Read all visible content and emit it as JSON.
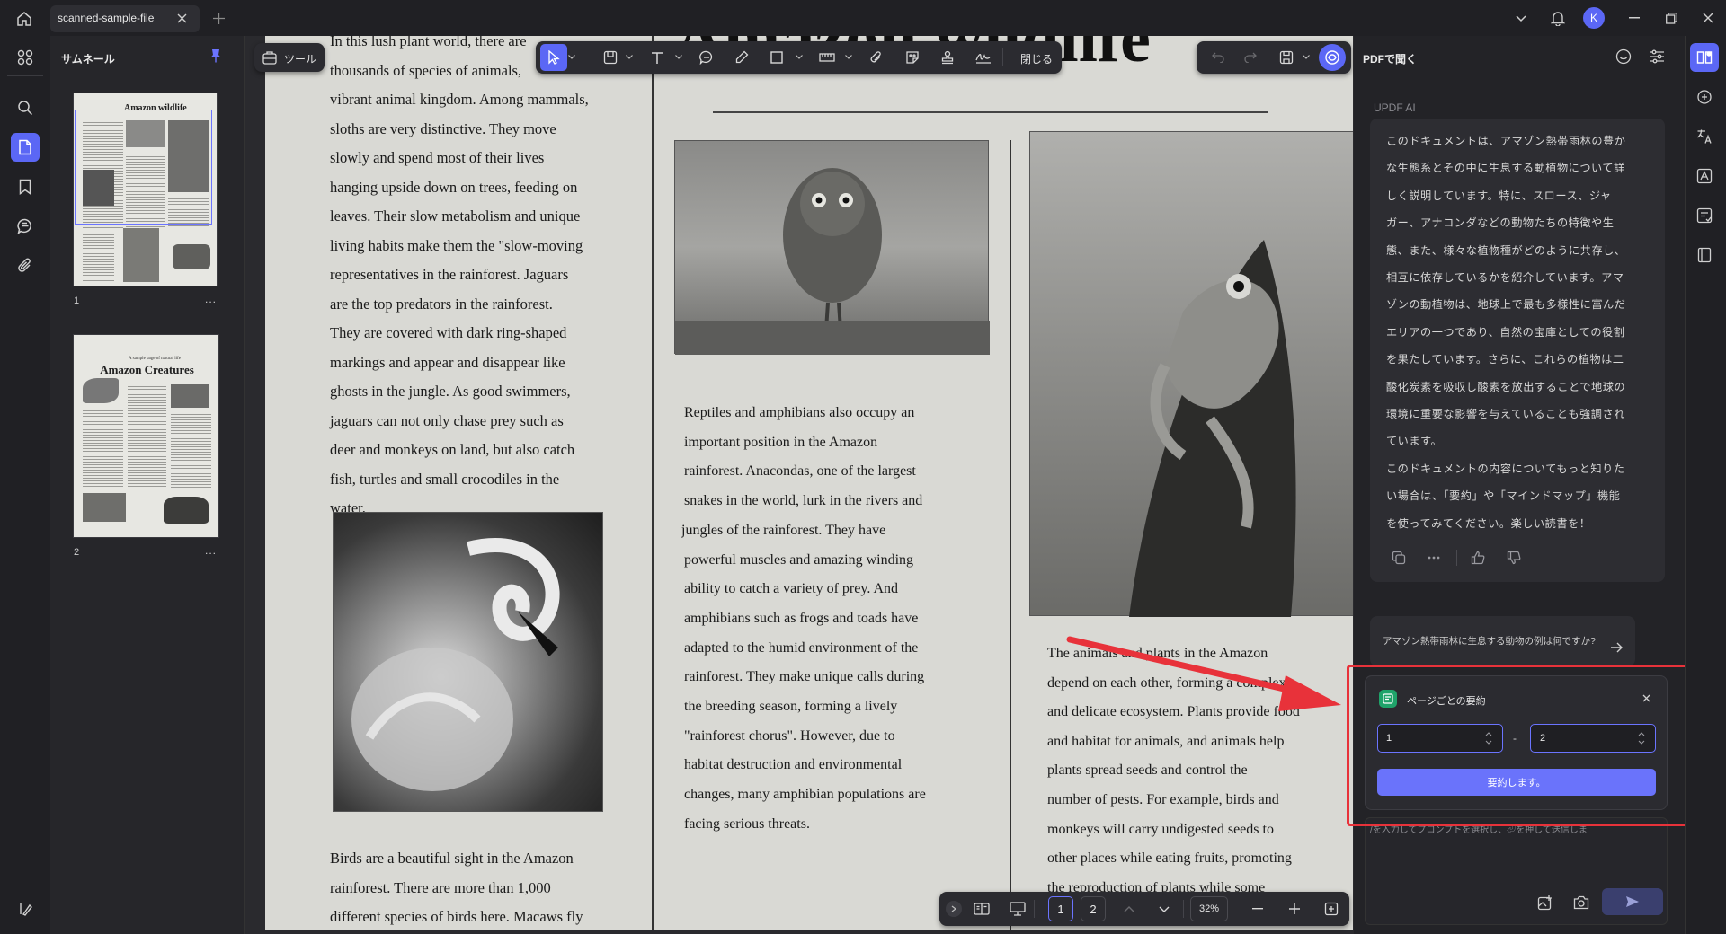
{
  "tabs": [
    {
      "title": "scanned-sample-file"
    }
  ],
  "user": {
    "avatar_initial": "K",
    "avatar_color": "#5b67f5"
  },
  "thumbnails": {
    "title": "サムネール",
    "pages": [
      {
        "number": "1",
        "heading": "Amazon wildlife",
        "more": "..."
      },
      {
        "number": "2",
        "heading": "Amazon Creatures",
        "kicker": "A sample page of natural life",
        "more": "..."
      }
    ]
  },
  "toolbar": {
    "tools_label": "ツール",
    "close_label": "閉じる"
  },
  "page_nav": {
    "pages": [
      "1",
      "2"
    ],
    "current": "1",
    "zoom": "32%"
  },
  "document": {
    "title": "Amazon wildlife",
    "col1_lines": [
      "In this lush plant world, there are",
      "thousands of species of animals,",
      "vibrant animal kingdom. Among mammals,",
      "sloths are very distinctive. They move",
      "slowly and spend most of their lives",
      "hanging upside down on trees, feeding on",
      "leaves. Their slow metabolism and unique",
      "living habits make them the \"slow-moving",
      "representatives in the rainforest. Jaguars",
      "are the top predators in the rainforest.",
      "They are covered with dark ring-shaped",
      "markings and appear and disappear like",
      "ghosts in the jungle. As good swimmers,",
      "jaguars can not only chase prey such as",
      "deer and monkeys on land, but also catch",
      "fish, turtles and small crocodiles in the",
      "water."
    ],
    "col1_bottom_lines": [
      "Birds are a beautiful sight in the Amazon",
      "rainforest.  There  are  more  than  1,000",
      "different species of birds here. Macaws fly"
    ],
    "col2_lines": [
      "Reptiles and amphibians also occupy an",
      "important position in the Amazon",
      "rainforest. Anacondas, one of the largest",
      "snakes in the world, lurk in the rivers and",
      "jungles of the rainforest. They have",
      "powerful muscles and amazing winding",
      "ability to catch a variety of prey. And",
      "amphibians such as frogs and toads have",
      "adapted to the humid environment of the",
      "rainforest. They make unique calls during",
      "the breeding season, forming a lively",
      "\"rainforest chorus\". However, due to",
      "habitat destruction and environmental",
      "changes, many amphibian populations are",
      "facing serious threats."
    ],
    "col3_lines": [
      "The animals and plants in the Amazon",
      "depend on each other, forming a complex",
      "and delicate ecosystem. Plants provide food",
      "and habitat for animals, and animals help",
      "plants spread seeds and control the",
      "number of pests. For example, birds and",
      "monkeys will carry undigested seeds to",
      "other places while eating fruits, promoting",
      "the reproduction of plants while some"
    ]
  },
  "right_panel": {
    "header": "PDFで聞く",
    "ai_label": "UPDF AI",
    "ai_message_lines": [
      "このドキュメントは、アマゾン熱帯雨林の豊か",
      "な生態系とその中に生息する動植物について詳",
      "しく説明しています。特に、スロース、ジャ",
      "ガー、アナコンダなどの動物たちの特徴や生",
      "態、また、様々な植物種がどのように共存し、",
      "相互に依存しているかを紹介しています。アマ",
      "ゾンの動植物は、地球上で最も多様性に富んだ",
      "エリアの一つであり、自然の宝庫としての役割",
      "を果たしています。さらに、これらの植物は二",
      "酸化炭素を吸収し酸素を放出することで地球の",
      "環境に重要な影響を与えていることも強調され",
      "ています。",
      "このドキュメントの内容についてもっと知りた",
      "い場合は、「要約」や「マインドマップ」機能",
      "を使ってみてください。楽しい読書を！"
    ],
    "suggestion": "アマゾン熱帯雨林に生息する動物の例は何ですか?",
    "popup": {
      "title": "ページごとの要約",
      "from_value": "1",
      "separator": "-",
      "to_value": "2",
      "button": "要約します。"
    },
    "prompt_placeholder": "/を入力してプロンプトを選択し、⏎を押して送信しま"
  },
  "colors": {
    "accent": "#5b67f5",
    "highlight_frame": "#e8323a"
  }
}
